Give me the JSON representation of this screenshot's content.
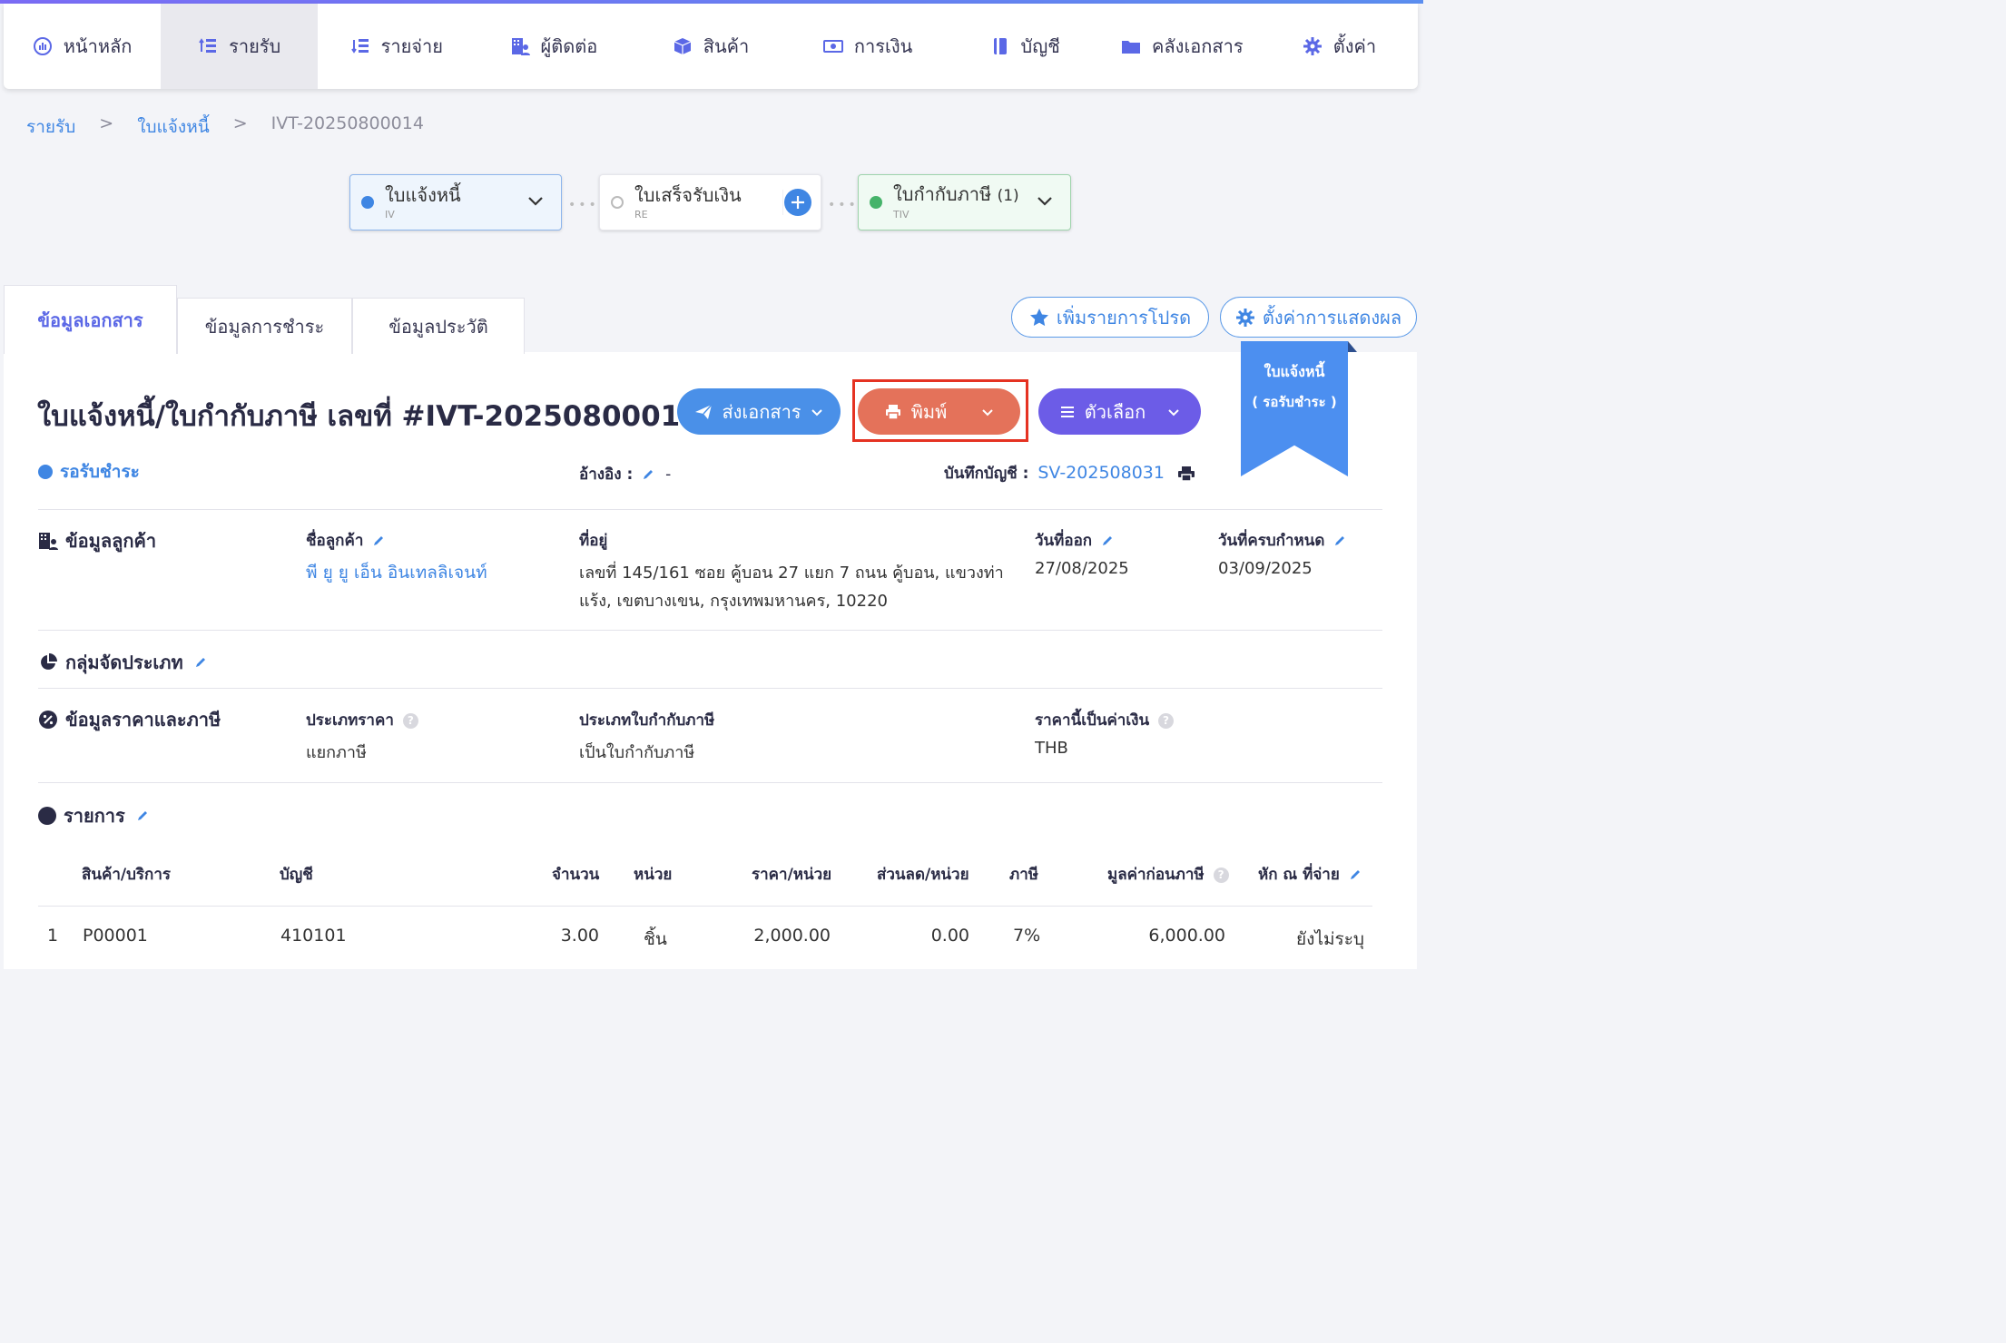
{
  "nav": {
    "items": [
      {
        "label": "หน้าหลัก",
        "icon": "dashboard-icon"
      },
      {
        "label": "รายรับ",
        "icon": "income-icon"
      },
      {
        "label": "รายจ่าย",
        "icon": "expense-icon"
      },
      {
        "label": "ผู้ติดต่อ",
        "icon": "contacts-icon"
      },
      {
        "label": "สินค้า",
        "icon": "box-icon"
      },
      {
        "label": "การเงิน",
        "icon": "money-icon"
      },
      {
        "label": "บัญชี",
        "icon": "ledger-icon"
      },
      {
        "label": "คลังเอกสาร",
        "icon": "folder-icon"
      },
      {
        "label": "ตั้งค่า",
        "icon": "gear-icon"
      }
    ],
    "active_index": 1
  },
  "breadcrumb": {
    "level1": "รายรับ",
    "level2": "ใบแจ้งหนี้",
    "sep": ">",
    "current": "IVT-20250800014"
  },
  "flow": {
    "iv": {
      "label": "ใบแจ้งหนี้",
      "code": "IV"
    },
    "re": {
      "label": "ใบเสร็จรับเงิน",
      "code": "RE"
    },
    "tiv": {
      "label": "ใบกำกับภาษี",
      "count": "(1)",
      "code": "TIV"
    }
  },
  "tabs": {
    "doc_info": "ข้อมูลเอกสาร",
    "payment_info": "ข้อมูลการชำระ",
    "history_info": "ข้อมูลประวัติ"
  },
  "actions": {
    "favorite": "เพิ่มรายการโปรด",
    "display_settings": "ตั้งค่าการแสดงผล",
    "send": "ส่งเอกสาร",
    "print": "พิมพ์",
    "options": "ตัวเลือก"
  },
  "ribbon": {
    "line1": "ใบแจ้งหนี้",
    "line2": "( รอรับชำระ )"
  },
  "doc": {
    "title": "ใบแจ้งหนี้/ใบกำกับภาษี เลขที่ #IVT-20250800014",
    "status": "รอรับชำระ",
    "reference_label": "อ้างอิง :",
    "reference_value": "-",
    "journal_label": "บันทึกบัญชี :",
    "journal_value": "SV-202508031"
  },
  "customer": {
    "section": "ข้อมูลลูกค้า",
    "name_label": "ชื่อลูกค้า",
    "name": "พี ยู ยู เอ็น อินเทลลิเจนท์",
    "address_label": "ที่อยู่",
    "address_line1": "เลขที่ 145/161 ซอย คู้บอน 27 แยก 7 ถนน คู้บอน, แขวงท่า",
    "address_line2": "แร้ง, เขตบางเขน, กรุงเทพมหานคร, 10220",
    "issue_label": "วันที่ออก",
    "issue_date": "27/08/2025",
    "due_label": "วันที่ครบกำหนด",
    "due_date": "03/09/2025"
  },
  "category": {
    "section": "กลุ่มจัดประเภท"
  },
  "pricing": {
    "section": "ข้อมูลราคาและภาษี",
    "price_type_label": "ประเภทราคา",
    "price_type": "แยกภาษี",
    "tax_doc_label": "ประเภทใบกำกับภาษี",
    "tax_doc": "เป็นใบกำกับภาษี",
    "currency_label": "ราคานี้เป็นค่าเงิน",
    "currency": "THB"
  },
  "items": {
    "section": "รายการ",
    "columns": {
      "product": "สินค้า/บริการ",
      "account": "บัญชี",
      "qty": "จำนวน",
      "unit": "หน่วย",
      "price": "ราคา/หน่วย",
      "discount": "ส่วนลด/หน่วย",
      "tax": "ภาษี",
      "pretax": "มูลค่าก่อนภาษี",
      "wht": "หัก ณ ที่จ่าย"
    },
    "rows": [
      {
        "no": "1",
        "product": "P00001",
        "account": "410101",
        "qty": "3.00",
        "unit": "ชิ้น",
        "price": "2,000.00",
        "discount": "0.00",
        "tax": "7%",
        "pretax": "6,000.00",
        "wht": "ยังไม่ระบุ"
      }
    ]
  },
  "colors": {
    "accent": "#5b68e6",
    "link": "#3f86e3",
    "print": "#e4725a",
    "options": "#6c5ce7",
    "send": "#4a90e8"
  }
}
